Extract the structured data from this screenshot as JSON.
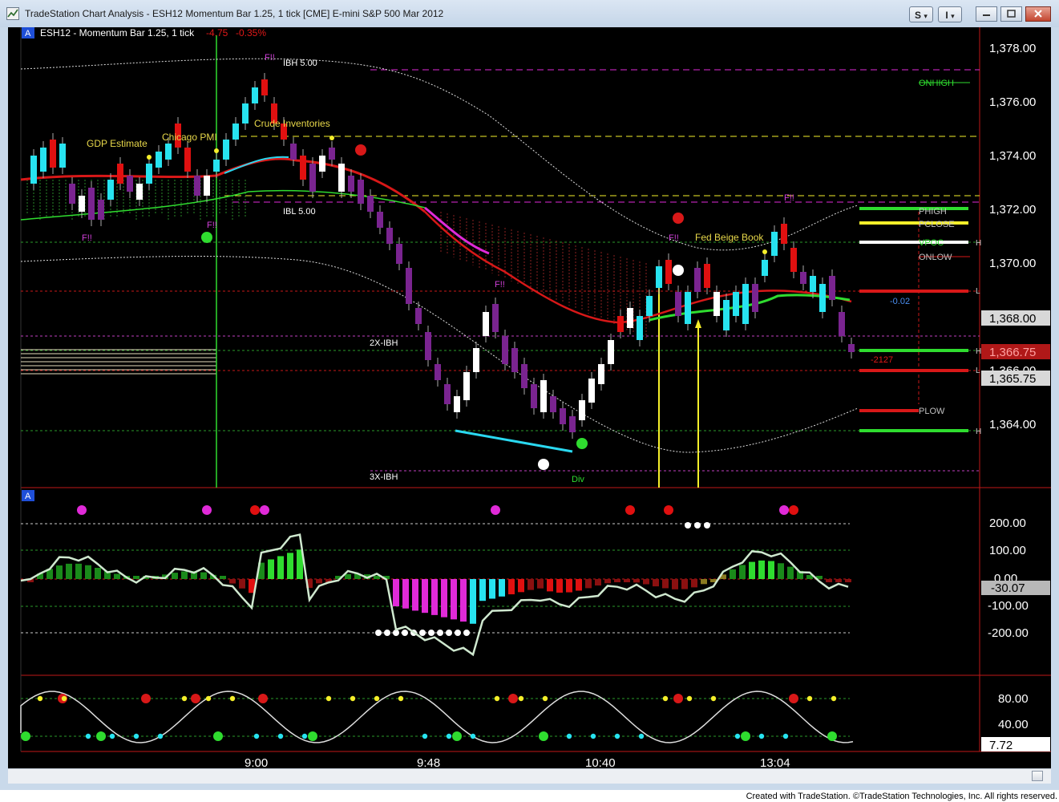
{
  "window": {
    "title": "TradeStation Chart Analysis - ESH12 Momentum Bar 1.25, 1 tick [CME] E-mini S&P 500 Mar 2012",
    "toolbar_s": "S",
    "toolbar_i": "I",
    "toolbar_dropdown": "▾"
  },
  "chart": {
    "symbol_badge": "A",
    "symbol_label": "ESH12 - Momentum Bar 1.25,  1 tick",
    "change_points": "-4.75",
    "change_percent": "-0.35%",
    "sub_badge": "A"
  },
  "price_axis": {
    "ticks": [
      "1,378.00",
      "1,376.00",
      "1,374.00",
      "1,372.00",
      "1,370.00",
      "1,368.00",
      "1,366.00",
      "1,364.00"
    ],
    "label_1368": "1,368.00",
    "label_current": "1,366.75",
    "label_1365": "1,365.75"
  },
  "level_labels": {
    "onhigh": "ONHIGH",
    "phigh": "PHIGH",
    "pclose": "PCLOSE",
    "vpoc": "VPOC",
    "onlow": "ONLOW",
    "plow": "PLOW"
  },
  "side_values": {
    "value_a": "-0.02",
    "value_b": "-2127",
    "tick_l1": "L",
    "tick_l2": "L",
    "tick_h1": "H",
    "tick_h2": "H",
    "tick_h3": "H"
  },
  "annotations": {
    "gdp": "GDP Estimate",
    "chicago": "Chicago PMI",
    "crude": "Crude Inventories",
    "beige": "Fed Beige Book",
    "ibh": "IBH  5.00",
    "ibl": "IBL  5.00",
    "x2ibh": "2X-IBH",
    "x3ibh": "3X-IBH",
    "div": "Div",
    "fl": "F!!"
  },
  "osc_axis": {
    "ticks": [
      "200.00",
      "100.00",
      "0.00",
      "-100.00",
      "-200.00"
    ],
    "current": "-30.07"
  },
  "stoch_axis": {
    "ticks": [
      "80.00",
      "40.00"
    ],
    "current": "7.72"
  },
  "time_axis": {
    "ticks": [
      "9:00",
      "9:48",
      "10:40",
      "13:04"
    ]
  },
  "footer": {
    "credit": "Created with TradeStation. ©TradeStation Technologies, Inc. All rights reserved."
  },
  "colors": {
    "up_bar": "#27e3f0",
    "down_bar": "#e01010",
    "white_bar": "#ffffff",
    "purple_bar": "#7a2490",
    "green_line": "#2fdc2f",
    "red_line": "#d81818",
    "magenta_line": "#e02ad8",
    "cyan_line": "#2ad8f0",
    "yellow": "#f5ef2a",
    "text_yellow": "#e8d84a",
    "text_magenta": "#d040d8",
    "panel_border": "#c01818",
    "axis_text": "#ffffff"
  }
}
